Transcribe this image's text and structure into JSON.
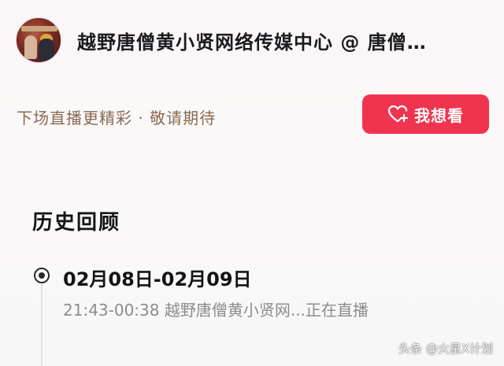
{
  "header": {
    "avatar": "streamer-avatar",
    "streamer_name": "越野唐僧黄小贤网络传媒中心 @ 唐僧…"
  },
  "status": {
    "tagline": "下场直播更精彩 · 敬请期待",
    "want_button_label": "我想看",
    "want_button_icon": "heart-plus-icon",
    "accent_color": "#f0344f"
  },
  "history": {
    "title": "历史回顾",
    "records": [
      {
        "date_range": "02月08日-02月09日",
        "detail": "21:43-00:38 越野唐僧黄小贤网...正在直播"
      }
    ]
  },
  "watermark": {
    "text": "头条 @火星X计划"
  }
}
